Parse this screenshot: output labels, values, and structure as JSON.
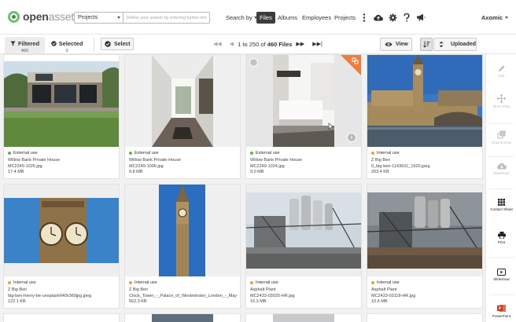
{
  "brand": {
    "logo_bold": "open",
    "logo_light": "asset"
  },
  "search": {
    "scope": "Projects",
    "placeholder": "Refine your search by entering further terms"
  },
  "nav": {
    "search_by": "Search by",
    "files": "Files",
    "albums": "Albums",
    "employees": "Employees",
    "projects": "Projects"
  },
  "header_icons": [
    "more-icon",
    "upload-cloud-icon",
    "settings-icon",
    "help-icon",
    "announcement-icon"
  ],
  "user": {
    "name": "Axomic"
  },
  "toolbar": {
    "filtered_label": "Filtered",
    "filtered_count": "460",
    "selected_label": "Selected",
    "selected_count": "0",
    "select_label": "Select",
    "pager_prefix": "1 to 250 of",
    "pager_total": "460 Files",
    "view_label": "View",
    "sort_label": "Uploaded"
  },
  "colors": {
    "external": "#6ab04c",
    "internal": "#f0a030",
    "badge": "#f07d3a",
    "accent": "#3d3d3d"
  },
  "files": [
    {
      "usage": "External use",
      "project": "Willow Bank Private House",
      "filename": "MC2249-1026.jpg",
      "size": "17.4 MB",
      "image": "house-exterior"
    },
    {
      "usage": "External use",
      "project": "Willow Bank Private House",
      "filename": "MC2249-1006.jpg",
      "size": "9.8 MB",
      "image": "house-corridor"
    },
    {
      "usage": "External use",
      "project": "Willow Bank Private House",
      "filename": "MC2249-1024.jpg",
      "size": "9.0 MB",
      "image": "house-kitchen"
    },
    {
      "usage": "Internal use",
      "project": "Z Big Ben",
      "filename": "0_big-ben-1143631_1920.jpeg",
      "size": "203.4 KB",
      "image": "big-ben-river"
    },
    {
      "usage": "Internal use",
      "project": "Z Big Ben",
      "filename": "big-ben-henry-be-unsplash640x360jpg.jpeg",
      "size": "122.1 KB",
      "image": "big-ben-clock"
    },
    {
      "usage": "Internal use",
      "project": "Z Big Ben",
      "filename": "Clock_Tower_-_Palace_of_Westminster_London_-_May_...",
      "size": "562.3 KB",
      "image": "big-ben-tower"
    },
    {
      "usage": "Internal use",
      "project": "Asphalt Plant",
      "filename": "MC2433-03025-HR.jpg",
      "size": "10.3 MB",
      "image": "asphalt-plant-1"
    },
    {
      "usage": "Internal use",
      "project": "Asphalt Plant",
      "filename": "MC2433-03118-HR.jpg",
      "size": "10.6 MB",
      "image": "asphalt-plant-2"
    }
  ],
  "sidebar": [
    {
      "icon": "edit-icon",
      "label": "Edit",
      "enabled": false
    },
    {
      "icon": "move-files-icon",
      "label": "Move Files",
      "enabled": false
    },
    {
      "icon": "drag-drop-icon",
      "label": "Drag & Drop",
      "enabled": false
    },
    {
      "icon": "download-icon",
      "label": "Download",
      "enabled": false
    },
    {
      "icon": "contact-sheet-icon",
      "label": "Contact Sheet",
      "enabled": true
    },
    {
      "icon": "print-icon",
      "label": "Print",
      "enabled": true
    },
    {
      "icon": "slideshow-icon",
      "label": "Slideshow",
      "enabled": true
    },
    {
      "icon": "powerpoint-icon",
      "label": "PowerPoint",
      "enabled": true
    }
  ]
}
